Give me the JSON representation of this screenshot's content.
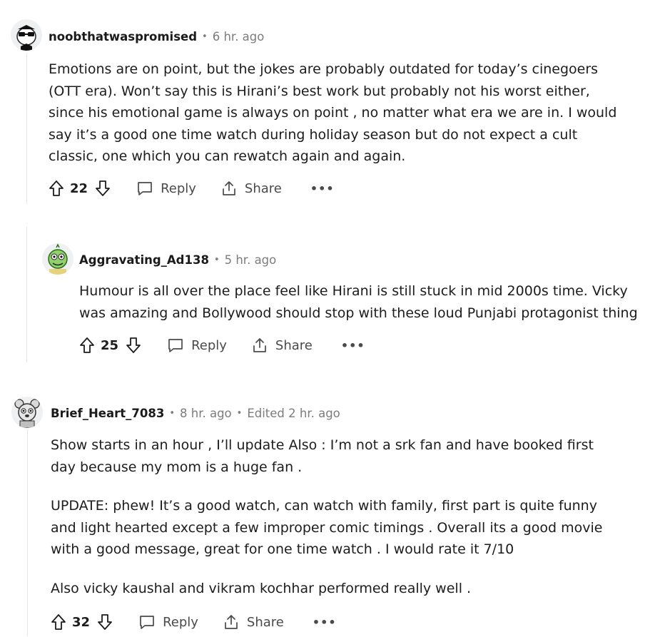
{
  "comments": [
    {
      "username": "noobthatwaspromised",
      "time": "6 hr. ago",
      "edited": "",
      "paragraphs": [
        "Emotions are on point, but the jokes are probably outdated for today’s cinegoers (OTT era). Won’t say this is Hirani’s best work but probably not his worst either, since his emotional game is always on point , no matter what era we are in. I would say it’s a good one time watch during holiday season but do not expect a cult classic, one which you can rewatch again and again."
      ],
      "score": "22",
      "reply_label": "Reply",
      "share_label": "Share",
      "more_label": "•••"
    },
    {
      "username": "Aggravating_Ad138",
      "time": "5 hr. ago",
      "edited": "",
      "paragraphs": [
        "Humour is all over the place feel like Hirani is still stuck in mid 2000s time. Vicky was amazing and Bollywood should stop with these loud Punjabi protagonist thing"
      ],
      "score": "25",
      "reply_label": "Reply",
      "share_label": "Share",
      "more_label": "•••"
    },
    {
      "username": "Brief_Heart_7083",
      "time": "8 hr. ago",
      "edited": "Edited 2 hr. ago",
      "paragraphs": [
        "Show starts in an hour , I’ll update Also : I’m not a srk fan and have booked first day because my mom is a huge fan .",
        "UPDATE: phew! It’s a good watch, can watch with family, first part is quite funny and light hearted except a few improper comic timings . Overall its a good movie with a good message, great for one time watch . I would rate it 7/10",
        "Also vicky kaushal and vikram kochhar performed really well ."
      ],
      "score": "32",
      "reply_label": "Reply",
      "share_label": "Share",
      "more_label": "•••"
    }
  ],
  "icons": {
    "upvote": "arrow-up-outline",
    "downvote": "arrow-down-outline",
    "reply": "speech-bubble",
    "share": "share-upload",
    "more": "ellipsis-horizontal"
  },
  "colors": {
    "text": "#1c1c1c",
    "meta": "#7c7c7c",
    "icon": "#4a4a4a",
    "thread_line": "#e4e6e8"
  }
}
